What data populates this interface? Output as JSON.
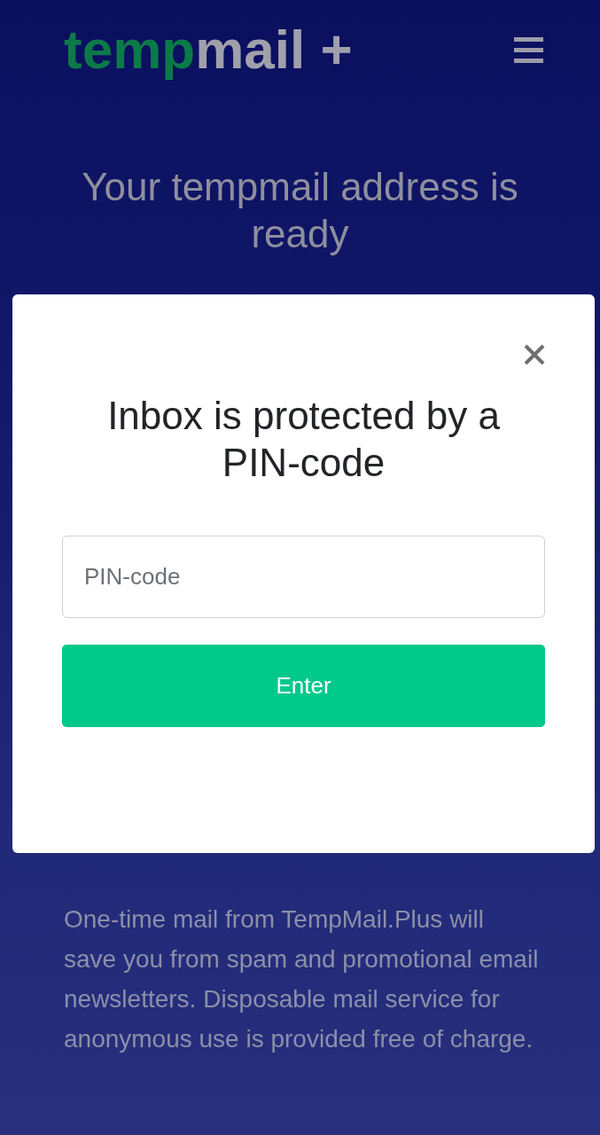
{
  "header": {
    "logo": [
      {
        "text": "temp",
        "kind": "accent"
      },
      {
        "text": "mail +",
        "kind": "plain"
      }
    ]
  },
  "hero": {
    "title": "Your tempmail address is ready"
  },
  "modal": {
    "title": "Inbox is protected by a PIN-code",
    "field": {
      "placeholder": "PIN-code"
    },
    "button": {
      "label": "Enter"
    }
  },
  "description": "One-time mail from TempMail.Plus will save you from spam and promotional email newsletters. Disposable mail service for anonymous use is provided free of charge."
}
